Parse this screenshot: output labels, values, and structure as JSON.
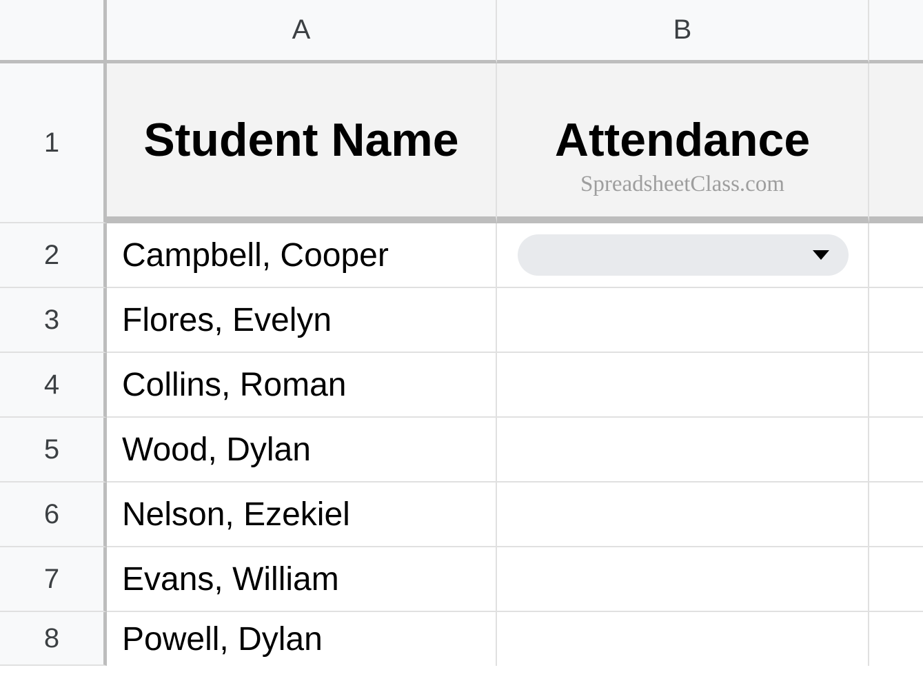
{
  "columns": {
    "A": "A",
    "B": "B"
  },
  "header": {
    "student_name": "Student Name",
    "attendance": "Attendance"
  },
  "watermark": "SpreadsheetClass.com",
  "rows": [
    {
      "num": "1"
    },
    {
      "num": "2",
      "name": "Campbell, Cooper",
      "has_chip": true
    },
    {
      "num": "3",
      "name": "Flores, Evelyn"
    },
    {
      "num": "4",
      "name": "Collins, Roman"
    },
    {
      "num": "5",
      "name": "Wood, Dylan"
    },
    {
      "num": "6",
      "name": "Nelson, Ezekiel"
    },
    {
      "num": "7",
      "name": "Evans, William"
    },
    {
      "num": "8",
      "name": "Powell, Dylan"
    }
  ]
}
